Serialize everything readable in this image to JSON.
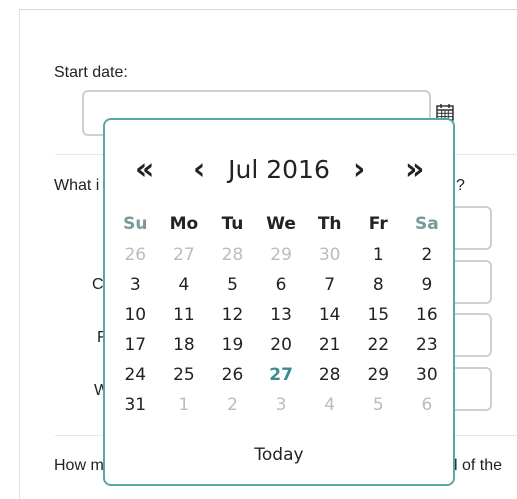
{
  "form": {
    "start_date_label": "Start date:",
    "start_date_value": "",
    "question1_prefix": "What i",
    "question1_suffix": "?",
    "row_labels": [
      "C",
      "F",
      "W"
    ],
    "question2_prefix": "How m",
    "question2_suffix": "l of the"
  },
  "datepicker": {
    "month_year": "Jul 2016",
    "prev_year": "«",
    "prev_month": "‹",
    "next_month": "›",
    "next_year": "»",
    "weekdays": [
      "Su",
      "Mo",
      "Tu",
      "We",
      "Th",
      "Fr",
      "Sa"
    ],
    "weeks": [
      [
        {
          "d": "26",
          "s": "muted"
        },
        {
          "d": "27",
          "s": "muted"
        },
        {
          "d": "28",
          "s": "muted"
        },
        {
          "d": "29",
          "s": "muted"
        },
        {
          "d": "30",
          "s": "muted"
        },
        {
          "d": "1",
          "s": "cur"
        },
        {
          "d": "2",
          "s": "cur"
        }
      ],
      [
        {
          "d": "3",
          "s": "cur"
        },
        {
          "d": "4",
          "s": "cur"
        },
        {
          "d": "5",
          "s": "cur"
        },
        {
          "d": "6",
          "s": "cur"
        },
        {
          "d": "7",
          "s": "cur"
        },
        {
          "d": "8",
          "s": "cur"
        },
        {
          "d": "9",
          "s": "cur"
        }
      ],
      [
        {
          "d": "10",
          "s": "cur"
        },
        {
          "d": "11",
          "s": "cur"
        },
        {
          "d": "12",
          "s": "cur"
        },
        {
          "d": "13",
          "s": "cur"
        },
        {
          "d": "14",
          "s": "cur"
        },
        {
          "d": "15",
          "s": "cur"
        },
        {
          "d": "16",
          "s": "cur"
        }
      ],
      [
        {
          "d": "17",
          "s": "cur"
        },
        {
          "d": "18",
          "s": "cur"
        },
        {
          "d": "19",
          "s": "cur"
        },
        {
          "d": "20",
          "s": "cur"
        },
        {
          "d": "21",
          "s": "cur"
        },
        {
          "d": "22",
          "s": "cur"
        },
        {
          "d": "23",
          "s": "cur"
        }
      ],
      [
        {
          "d": "24",
          "s": "cur"
        },
        {
          "d": "25",
          "s": "cur"
        },
        {
          "d": "26",
          "s": "cur"
        },
        {
          "d": "27",
          "s": "today"
        },
        {
          "d": "28",
          "s": "cur"
        },
        {
          "d": "29",
          "s": "cur"
        },
        {
          "d": "30",
          "s": "cur"
        }
      ],
      [
        {
          "d": "31",
          "s": "cur"
        },
        {
          "d": "1",
          "s": "muted"
        },
        {
          "d": "2",
          "s": "muted"
        },
        {
          "d": "3",
          "s": "muted"
        },
        {
          "d": "4",
          "s": "muted"
        },
        {
          "d": "5",
          "s": "muted"
        },
        {
          "d": "6",
          "s": "muted"
        }
      ]
    ],
    "today_label": "Today",
    "accent_color": "#5aa6a6",
    "today_color": "#3a8c8c"
  },
  "icons": {
    "calendar": "calendar-icon"
  }
}
